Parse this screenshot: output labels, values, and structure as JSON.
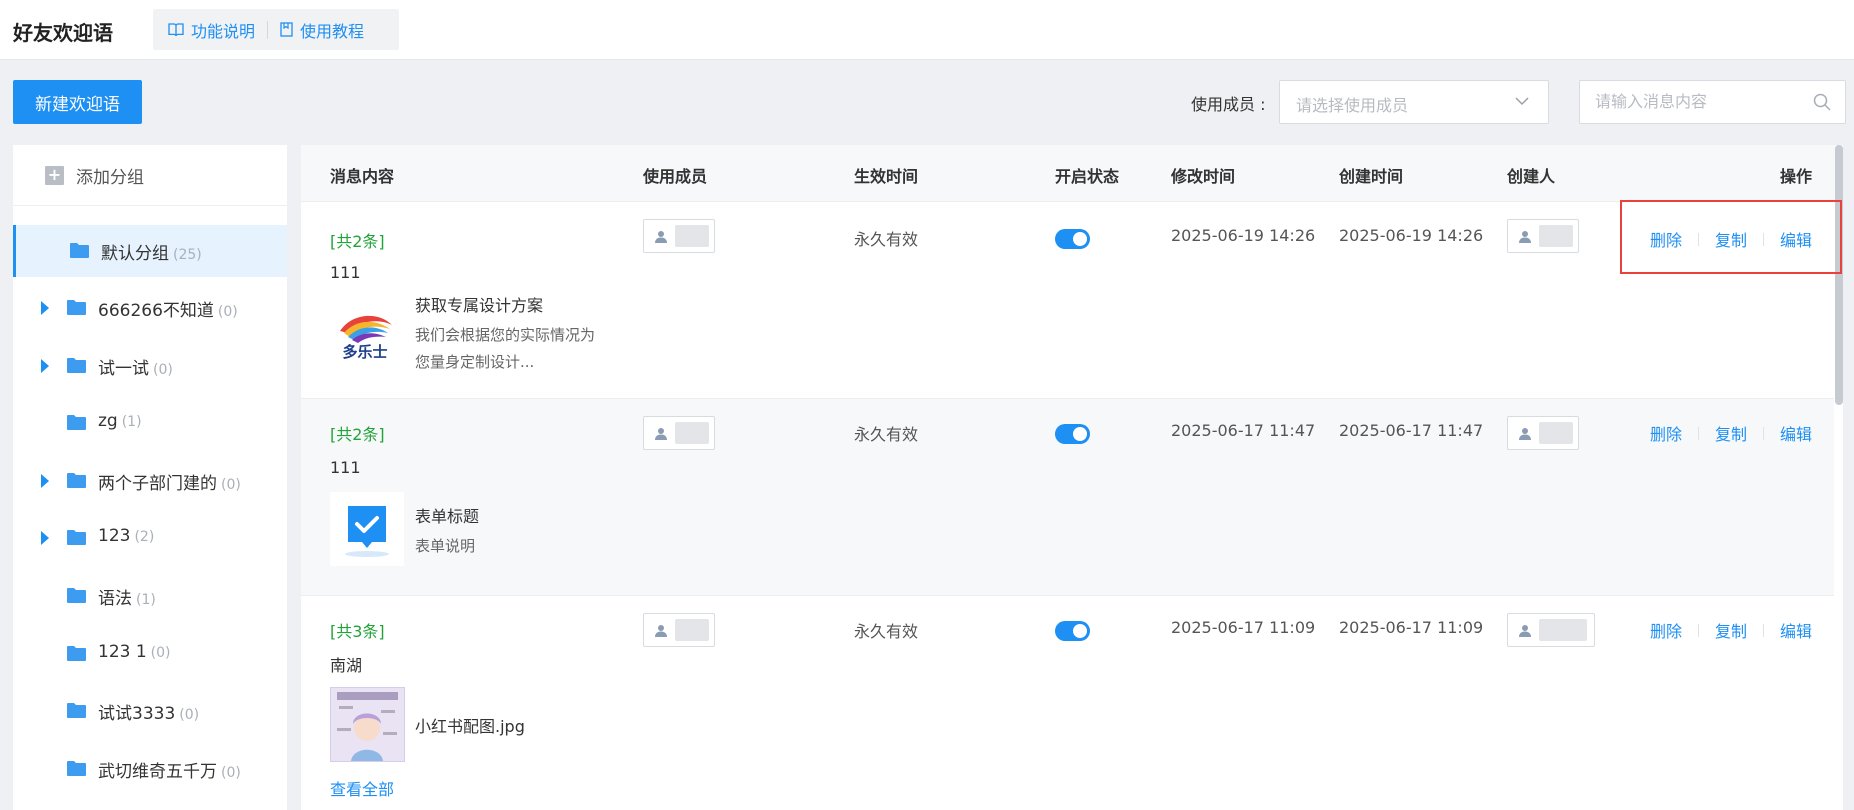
{
  "header": {
    "title": "好友欢迎语",
    "tabs": [
      {
        "label": "功能说明",
        "icon": "book-icon"
      },
      {
        "label": "使用教程",
        "icon": "document-icon"
      }
    ]
  },
  "toolbar": {
    "new_button": "新建欢迎语",
    "member_label": "使用成员 :",
    "member_placeholder": "请选择使用成员",
    "search_placeholder": "请输入消息内容"
  },
  "sidebar": {
    "add_group": "添加分组",
    "groups": [
      {
        "name": "默认分组",
        "count": "(25)",
        "expandable": false,
        "active": true
      },
      {
        "name": "666266不知道",
        "count": "(0)",
        "expandable": true
      },
      {
        "name": "试一试",
        "count": "(0)",
        "expandable": true
      },
      {
        "name": "zg",
        "count": "(1)",
        "expandable": false
      },
      {
        "name": "两个子部门建的",
        "count": "(0)",
        "expandable": true
      },
      {
        "name": "123",
        "count": "(2)",
        "expandable": true
      },
      {
        "name": "语法",
        "count": "(1)",
        "expandable": false
      },
      {
        "name": "123 1",
        "count": "(0)",
        "expandable": false
      },
      {
        "name": "试试3333",
        "count": "(0)",
        "expandable": false
      },
      {
        "name": "武切维奇五千万",
        "count": "(0)",
        "expandable": false
      }
    ]
  },
  "table": {
    "columns": [
      "消息内容",
      "使用成员",
      "生效时间",
      "开启状态",
      "修改时间",
      "创建时间",
      "创建人",
      "操作"
    ],
    "actions": {
      "delete": "删除",
      "copy": "复制",
      "edit": "编辑"
    },
    "rows": [
      {
        "count_label": "[共2条]",
        "text": "111",
        "attachment": {
          "type": "link",
          "title": "获取专属设计方案",
          "desc": "我们会根据您的实际情况为您量身定制设计...",
          "thumb_label": "多乐士"
        },
        "validity": "永久有效",
        "enabled": true,
        "modified": "2025-06-19 14:26",
        "created": "2025-06-19 14:26"
      },
      {
        "count_label": "[共2条]",
        "text": "111",
        "attachment": {
          "type": "form",
          "title": "表单标题",
          "desc": "表单说明"
        },
        "validity": "永久有效",
        "enabled": true,
        "modified": "2025-06-17 11:47",
        "created": "2025-06-17 11:47"
      },
      {
        "count_label": "[共3条]",
        "text": "南湖",
        "attachment": {
          "type": "image",
          "title": "小红书配图.jpg"
        },
        "view_all": "查看全部",
        "validity": "永久有效",
        "enabled": true,
        "modified": "2025-06-17 11:09",
        "created": "2025-06-17 11:09"
      }
    ]
  },
  "colors": {
    "accent": "#1e8ff3",
    "count_green": "#22a33a",
    "highlight_red": "#e8423a"
  }
}
